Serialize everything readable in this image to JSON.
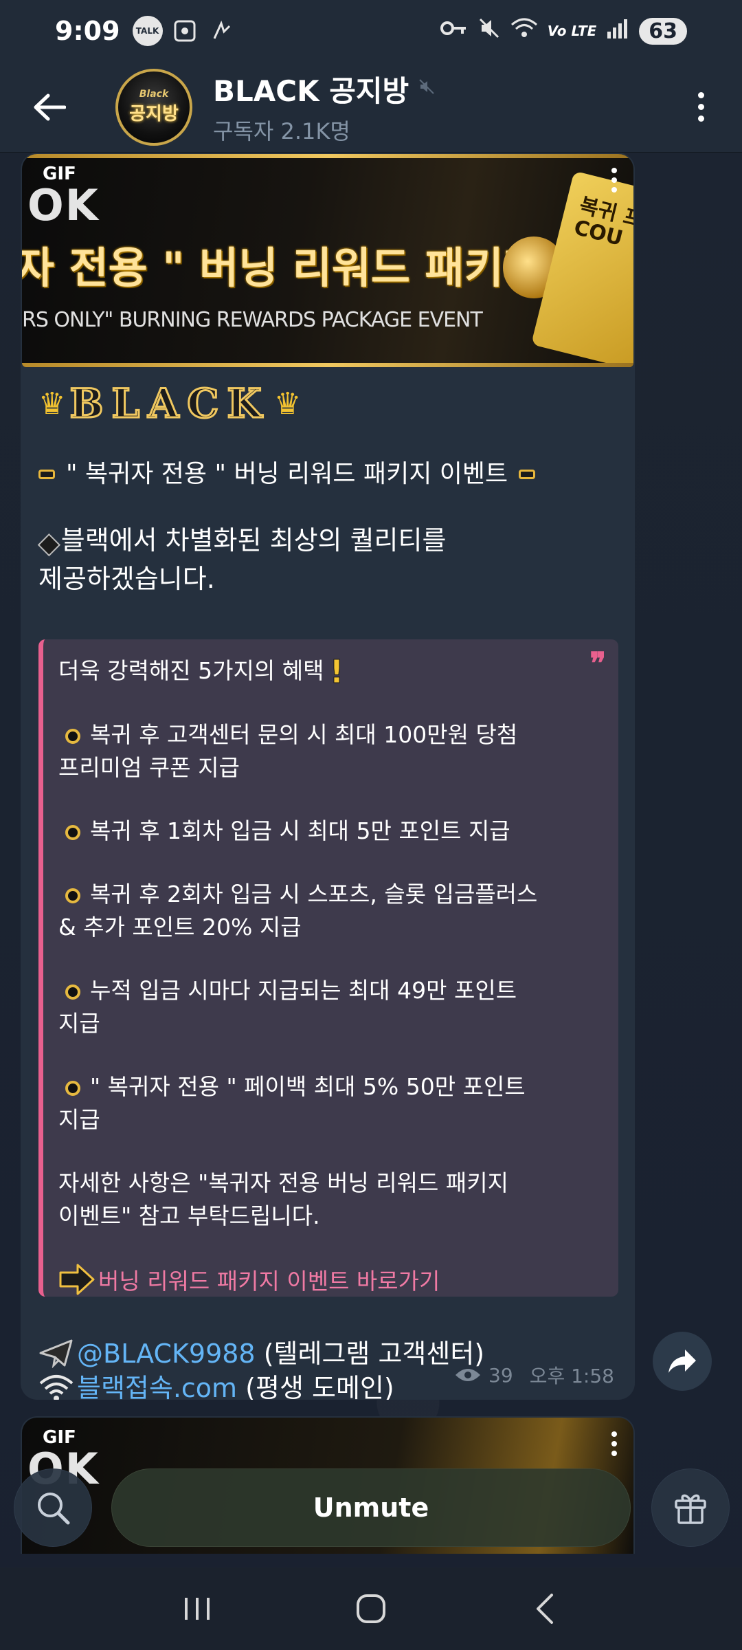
{
  "status_bar": {
    "time": "9:09",
    "talk_label": "TALK",
    "network": "Vo LTE",
    "battery": "63"
  },
  "header": {
    "avatar_small": "Black",
    "avatar_big": "공지방",
    "title": "BLACK 공지방",
    "subscribers": "구독자 2.1K명"
  },
  "post": {
    "gif_badge": "GIF",
    "banner_brand": "OK",
    "banner_headline": "자 전용 \" 버닝 리워드 패키지 이벤트",
    "banner_sub": "RS ONLY\" BURNING REWARDS PACKAGE EVENT",
    "banner_card": "복귀 프리 COU",
    "brand_letters": "BLACK",
    "event_title": "\" 복귀자 전용 \" 버닝 리워드 패키지 이벤트",
    "quality_line1": "블랙에서 차별화된 최상의 퀄리티를",
    "quality_line2": "제공하겠습니다.",
    "quote": {
      "heading": "더욱 강력해진 5가지의 혜택",
      "items": [
        {
          "line1": "복귀 후 고객센터 문의 시 최대 100만원 당첨",
          "line2": "프리미엄 쿠폰 지급"
        },
        {
          "line1": "복귀 후 1회차 입금 시 최대 5만 포인트 지급",
          "line2": ""
        },
        {
          "line1": "복귀 후 2회차 입금 시 스포츠, 슬롯 입금플러스",
          "line2": "& 추가 포인트 20% 지급"
        },
        {
          "line1": "누적 입금 시마다 지급되는 최대 49만 포인트",
          "line2": "지급"
        },
        {
          "line1": "\" 복귀자 전용 \" 페이백 최대 5% 50만 포인트",
          "line2": "지급"
        }
      ],
      "note_line1": "자세한 사항은 \"복귀자 전용 버닝 리워드 패키지",
      "note_line2": "이벤트\" 참고 부탁드립니다.",
      "link": "버닝 리워드 패키지 이벤트 바로가기"
    },
    "telegram_handle": "@BLACK9988",
    "telegram_label": "(텔레그램 고객센터)",
    "domain_link": "블랙접속.com",
    "domain_label": "(평생 도메인)",
    "views": "39",
    "time": "오후 1:58"
  },
  "post2": {
    "gif_badge": "GIF",
    "banner_brand": "OK"
  },
  "bottom": {
    "unmute_label": "Unmute"
  },
  "colors": {
    "accent_pink": "#e8608e",
    "link_blue": "#64b5f6",
    "gold": "#f0c860"
  }
}
